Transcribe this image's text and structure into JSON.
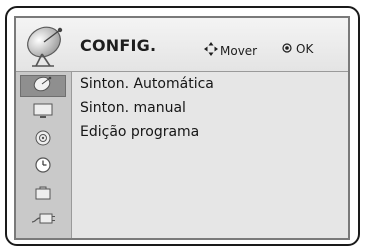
{
  "header": {
    "title": "CONFIG.",
    "move_hint": "Mover",
    "ok_hint": "OK",
    "icon": "satellite-dish-icon"
  },
  "sidebar": {
    "items": [
      {
        "icon": "antenna-icon",
        "active": true
      },
      {
        "icon": "tv-screen-icon",
        "active": false
      },
      {
        "icon": "speaker-icon",
        "active": false
      },
      {
        "icon": "clock-icon",
        "active": false
      },
      {
        "icon": "lock-box-icon",
        "active": false
      },
      {
        "icon": "input-plug-icon",
        "active": false
      }
    ]
  },
  "menu": {
    "items": [
      {
        "label": "Sinton. Automática"
      },
      {
        "label": "Sinton. manual"
      },
      {
        "label": "Edição programa"
      }
    ]
  },
  "colors": {
    "panel_bg": "#dadada",
    "active_item": "#8f8f8f",
    "text": "#161616"
  }
}
